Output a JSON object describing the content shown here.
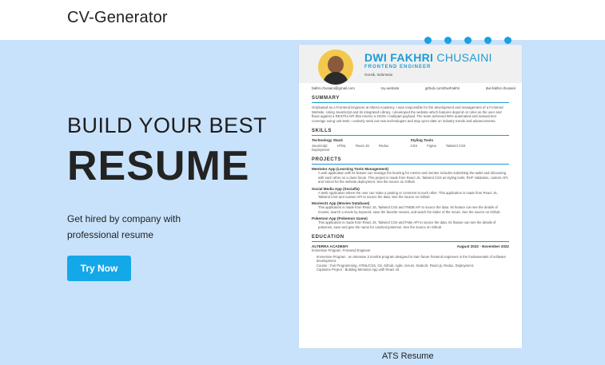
{
  "header": {
    "brand": "CV-Generator"
  },
  "hero": {
    "headline_1": "BUILD YOUR BEST",
    "headline_2": "RESUME",
    "subtext": "Get hired by company with professional resume",
    "cta_label": "Try Now"
  },
  "colors": {
    "hero_bg": "#c9e2fb",
    "accent": "#14a8e8",
    "resume_accent": "#1d9ad6"
  },
  "resume_preview": {
    "name_bold": "DWI FAKHRI",
    "name_light": "CHUSAINI",
    "role": "FRONTEND ENGINEER",
    "location": "Gresik, Indonesia",
    "contacts": [
      "fakhri.chusaini@gmail.com",
      "my-website",
      "github.com/DwiFakhri",
      "dwi-fakhri-chusaini"
    ],
    "summary_title": "SUMMARY",
    "summary": "Graduated as a Frontend Engineer at Alterra Academy. I was responsible for the development and management of a Frontend Website. Using JavaScript and its integrated Library, I developed the website which features depend on roles as the user and flows against a RESTful API that returns a JSON / multipart payload. The team achieved 95% automated and manual test coverage using unit tests. I actively seek out new technologies and stay up-to-date on industry trends and advancements.",
    "skills_title": "SKILLS",
    "skills": [
      {
        "head": "Technology Stack",
        "items": [
          "JavaScript",
          "HTML",
          "React JS",
          "Redux",
          "Deployment"
        ]
      },
      {
        "head": "Styling Tools",
        "items": [
          "CSS",
          "Figma",
          "Tailwind CSS"
        ]
      }
    ],
    "projects_title": "PROJECTS",
    "projects": [
      {
        "title": "Mentutor App (Learning Tools Management)",
        "desc": "A web application with its feature can manage the learning for mentor and mentee includes submitting the tasks and discussing with each other on a class forum. This project is made from React JS, Tailwind CSS as styling tools, RHF Validation, custom API, and Vercel for the website deployment. See the source on Github"
      },
      {
        "title": "Social Media App (Socialfa)",
        "desc": "A Web Application where the user can make a posting or comment to each other. This application is made from React JS, Tailwind CSS and custom API to source the data. See the source on Github"
      },
      {
        "title": "Movies21 App (Movies Database)",
        "desc": "This application is made from React JS, Tailwind CSS and TMDB API to source the data. Its feature can see the details of movies, search a movie by keyword, save the favorite movies, and watch the trailer of the movie. See the source on Github"
      },
      {
        "title": "Pokemon App (Pokemon Game)",
        "desc": "This application is made from React JS, Tailwind CSS and Poke API to source the data. Its feature can see the details of pokemon, save and give the name for catched pokemon. See the source on Github"
      }
    ],
    "education_title": "EDUCATION",
    "education": {
      "school": "ALTERRA ACADEMY",
      "period": "August 2022 - November 2022",
      "program": "Immersive Program, Frontend Engineer",
      "details": [
        "Immersive Program : an intensive 3 months program designed to train future frontend engineers in the fundamentals of software development.",
        "Course : Fair Programming, HTML/CSS, Git, Github, Agile, Scrum, NodeJS, React.js, Redux, Deployment.",
        "Capstone Project : Building Mentutor App with React JS."
      ]
    }
  },
  "caption": "ATS Resume"
}
